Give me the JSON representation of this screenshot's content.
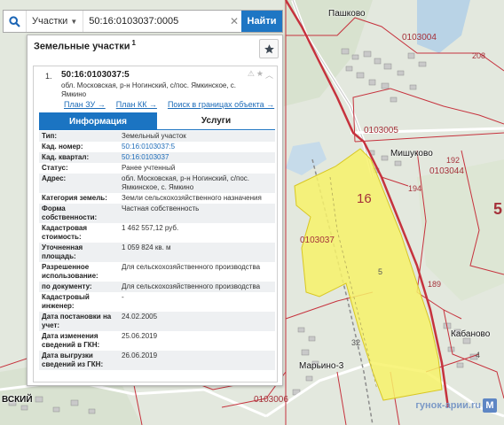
{
  "search": {
    "type_label": "Участки",
    "query": "50:16:0103037:0005",
    "button_label": "Найти"
  },
  "panel": {
    "title": "Земельные участки",
    "title_sup": "1",
    "result": {
      "number": "1.",
      "cad_number": "50:16:0103037:5",
      "address": "обл. Московская, р-н Ногинский, с/пос. Ямкинское, с. Ямкино",
      "links": [
        "План ЗУ →",
        "План КК →",
        "Поиск в границах объекта →"
      ]
    },
    "tabs": [
      "Информация",
      "Услуги"
    ],
    "rows": [
      {
        "key": "Тип:",
        "value": "Земельный участок"
      },
      {
        "key": "Кад. номер:",
        "value": "50:16:0103037:5"
      },
      {
        "key": "Кад. квартал:",
        "value": "50:16:0103037"
      },
      {
        "key": "Статус:",
        "value": "Ранее учтенный"
      },
      {
        "key": "Адрес:",
        "value": "обл. Московская, р-н Ногинский, с/пос. Ямкинское, с. Ямкино"
      },
      {
        "key": "Категория земель:",
        "value": "Земли сельскохозяйственного назначения"
      },
      {
        "key": "Форма собственности:",
        "value": "Частная собственность"
      },
      {
        "key": "Кадастровая стоимость:",
        "value": "1 462 557,12 руб."
      },
      {
        "key": "Уточненная площадь:",
        "value": "1 059 824 кв. м"
      },
      {
        "key": "Разрешенное использование:",
        "value": "Для сельскохозяйственного производства"
      },
      {
        "key": "по документу:",
        "value": "Для сельскохозяйственного производства"
      },
      {
        "key": "Кадастровый инженер:",
        "value": "-"
      },
      {
        "key": "Дата постановки на учет:",
        "value": "24.02.2005"
      },
      {
        "key": "Дата изменения сведений в ГКН:",
        "value": "25.06.2019"
      },
      {
        "key": "Дата выгрузки сведений из ГКН:",
        "value": "26.06.2019"
      }
    ]
  },
  "map": {
    "places": {
      "pashkovo": "Пашково",
      "mishukovo": "Мишуково",
      "kabanovo": "Кабаново",
      "marino": "Марьино-3",
      "vsky": "ВСКИЙ"
    },
    "quarters": {
      "q3004": "0103004",
      "q3005": "0103005",
      "q3044": "0103044",
      "q3037": "0103037",
      "q3006": "0103006"
    },
    "numbers": {
      "n208": "208",
      "n192": "192",
      "n194": "194",
      "n16": "16",
      "n189": "189",
      "n32": "32",
      "n4": "4",
      "n5": "5",
      "n5side": "5"
    },
    "watermark": "гунок-арии.ru",
    "watermark_icon": "М"
  }
}
